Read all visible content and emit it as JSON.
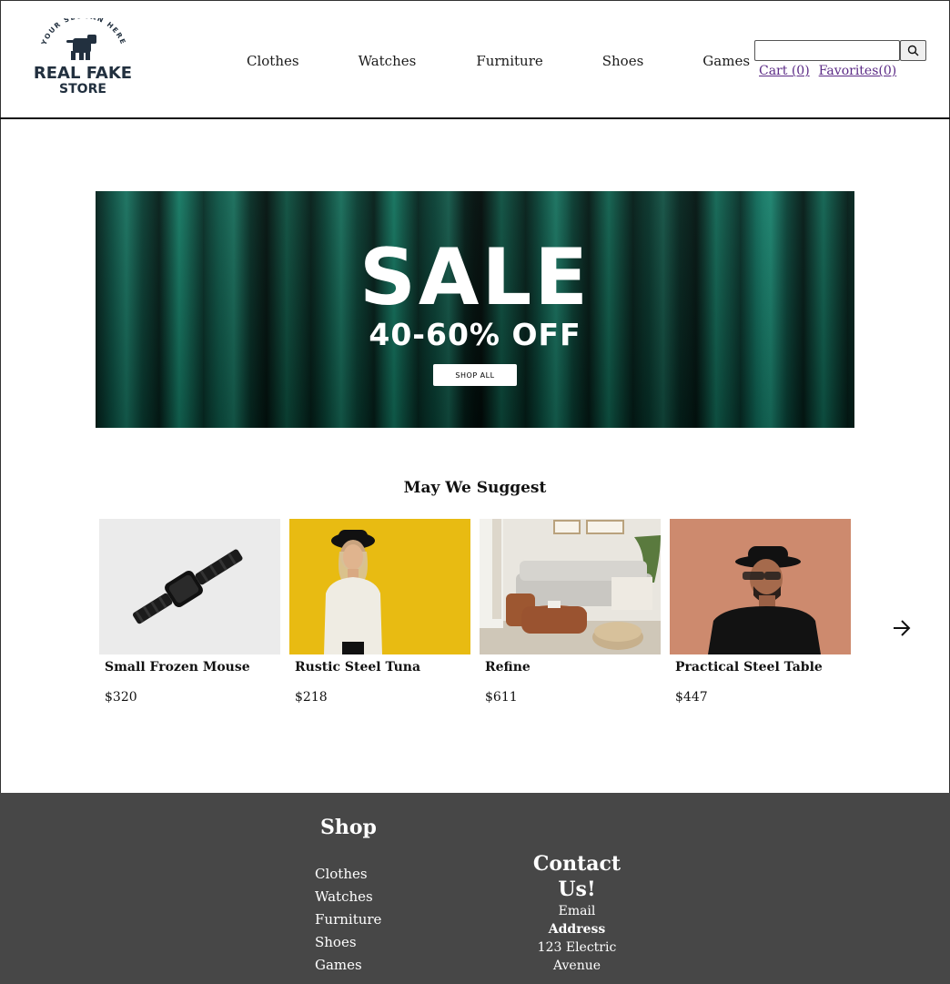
{
  "brand": {
    "slogan": "YOUR SLOGAN HERE",
    "name_line1": "REAL FAKE",
    "name_line2": "STORE",
    "color": "#22303f"
  },
  "nav": {
    "items": [
      "Clothes",
      "Watches",
      "Furniture",
      "Shoes",
      "Games"
    ]
  },
  "search": {
    "value": "",
    "placeholder": "",
    "icon": "search-icon"
  },
  "user_links": {
    "cart": "Cart (0)",
    "favorites": "Favorites(0)"
  },
  "hero": {
    "headline": "SALE",
    "subheadline": "40-60% OFF",
    "button": "SHOP ALL",
    "background_color": "#0d5f4e"
  },
  "suggestions": {
    "title": "May We Suggest",
    "products": [
      {
        "name": "Small Frozen Mouse",
        "price": "$320",
        "image": "smartwatch-photo"
      },
      {
        "name": "Rustic Steel Tuna",
        "price": "$218",
        "image": "woman-yellow-wall-photo"
      },
      {
        "name": "Refine",
        "price": "$611",
        "image": "living-room-photo"
      },
      {
        "name": "Practical Steel Table",
        "price": "$447",
        "image": "man-hat-sunglasses-photo"
      }
    ],
    "next_icon": "arrow-right-icon"
  },
  "footer": {
    "shop_title": "Shop",
    "shop_links": [
      "Clothes",
      "Watches",
      "Furniture",
      "Shoes",
      "Games"
    ],
    "contact_title": "Contact Us!",
    "email_label": "Email",
    "address_label": "Address",
    "address": "123 Electric Avenue",
    "background_color": "#474747"
  }
}
